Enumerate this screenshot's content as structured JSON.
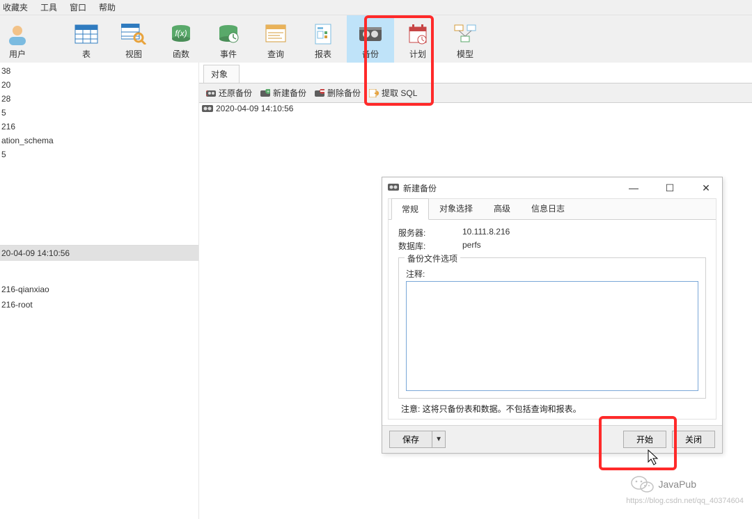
{
  "menu": {
    "favorites": "收藏夹",
    "tools": "工具",
    "window": "窗口",
    "help": "帮助"
  },
  "ribbon": {
    "user": "用户",
    "table": "表",
    "view": "视图",
    "func": "函数",
    "event": "事件",
    "query": "查询",
    "report": "报表",
    "backup": "备份",
    "schedule": "计划",
    "model": "模型"
  },
  "left": {
    "tree": [
      "38",
      "20",
      "28",
      "5",
      "216",
      "ation_schema",
      "5"
    ],
    "backup_item": "20-04-09 14:10:56",
    "connections": [
      "216-qianxiao",
      "216-root"
    ]
  },
  "right": {
    "tab_objects": "对象",
    "toolbar": {
      "restore": "还原备份",
      "new": "新建备份",
      "delete": "删除备份",
      "extract": "提取 SQL"
    },
    "list_item": "2020-04-09 14:10:56"
  },
  "dialog": {
    "title": "新建备份",
    "tabs": {
      "general": "常规",
      "object_select": "对象选择",
      "advanced": "高级",
      "log": "信息日志"
    },
    "server_label": "服务器:",
    "server_value": "10.111.8.216",
    "db_label": "数据库:",
    "db_value": "perfs",
    "group_legend": "备份文件选项",
    "comment_label": "注释:",
    "comment_value": "",
    "note": "注意: 这将只备份表和数据。不包括查询和报表。",
    "buttons": {
      "save": "保存",
      "start": "开始",
      "close": "关闭"
    },
    "caret": "▼"
  },
  "signature": {
    "brand": "JavaPub",
    "url": "https://blog.csdn.net/qq_40374604"
  },
  "glyph": {
    "min": "—",
    "max": "☐",
    "close": "✕"
  }
}
